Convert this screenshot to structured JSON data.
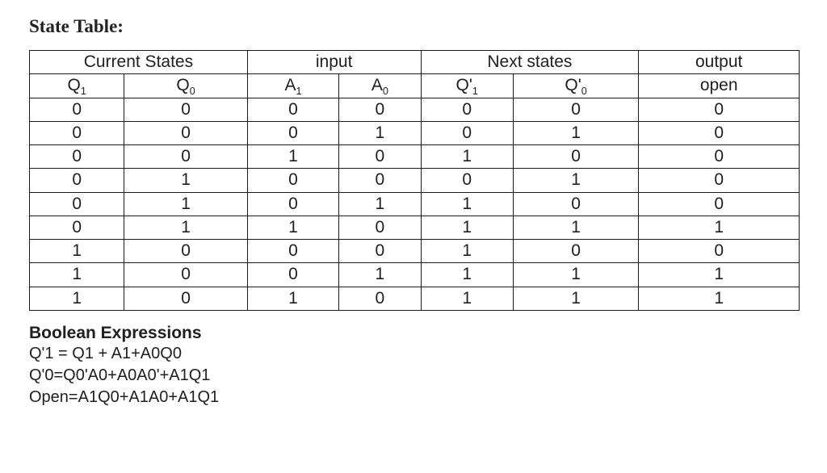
{
  "title": "State Table:",
  "headers": {
    "group_current": "Current States",
    "group_input": "input",
    "group_next": "Next states",
    "group_output": "output",
    "q1": {
      "base": "Q",
      "sub": "1"
    },
    "q0": {
      "base": "Q",
      "sub": "0"
    },
    "a1": {
      "base": "A",
      "sub": "1"
    },
    "a0": {
      "base": "A",
      "sub": "0"
    },
    "qp1": {
      "base": "Q'",
      "sub": "1"
    },
    "qp0": {
      "base": "Q'",
      "sub": "0"
    },
    "out": "open"
  },
  "rows": [
    {
      "q1": "0",
      "q0": "0",
      "a1": "0",
      "a0": "0",
      "qp1": "0",
      "qp0": "0",
      "open": "0"
    },
    {
      "q1": "0",
      "q0": "0",
      "a1": "0",
      "a0": "1",
      "qp1": "0",
      "qp0": "1",
      "open": "0"
    },
    {
      "q1": "0",
      "q0": "0",
      "a1": "1",
      "a0": "0",
      "qp1": "1",
      "qp0": "0",
      "open": "0"
    },
    {
      "q1": "0",
      "q0": "1",
      "a1": "0",
      "a0": "0",
      "qp1": "0",
      "qp0": "1",
      "open": "0"
    },
    {
      "q1": "0",
      "q0": "1",
      "a1": "0",
      "a0": "1",
      "qp1": "1",
      "qp0": "0",
      "open": "0"
    },
    {
      "q1": "0",
      "q0": "1",
      "a1": "1",
      "a0": "0",
      "qp1": "1",
      "qp0": "1",
      "open": "1"
    },
    {
      "q1": "1",
      "q0": "0",
      "a1": "0",
      "a0": "0",
      "qp1": "1",
      "qp0": "0",
      "open": "0"
    },
    {
      "q1": "1",
      "q0": "0",
      "a1": "0",
      "a0": "1",
      "qp1": "1",
      "qp0": "1",
      "open": "1"
    },
    {
      "q1": "1",
      "q0": "0",
      "a1": "1",
      "a0": "0",
      "qp1": "1",
      "qp0": "1",
      "open": "1"
    }
  ],
  "col_widths": {
    "q1": 117,
    "q0": 152,
    "a1": 113,
    "a0": 101,
    "qp1": 114,
    "qp0": 155,
    "open": 198
  },
  "expr_heading": "Boolean Expressions",
  "expr1": "Q'1 = Q1 + A1+A0Q0",
  "expr2": "Q'0=Q0'A0+A0A0'+A1Q1",
  "expr3": "Open=A1Q0+A1A0+A1Q1",
  "chart_data": {
    "type": "table",
    "title": "State Table",
    "columns": [
      "Q1",
      "Q0",
      "A1",
      "A0",
      "Q'1",
      "Q'0",
      "open"
    ],
    "column_groups": {
      "Current States": [
        "Q1",
        "Q0"
      ],
      "input": [
        "A1",
        "A0"
      ],
      "Next states": [
        "Q'1",
        "Q'0"
      ],
      "output": [
        "open"
      ]
    },
    "data": [
      [
        0,
        0,
        0,
        0,
        0,
        0,
        0
      ],
      [
        0,
        0,
        0,
        1,
        0,
        1,
        0
      ],
      [
        0,
        0,
        1,
        0,
        1,
        0,
        0
      ],
      [
        0,
        1,
        0,
        0,
        0,
        1,
        0
      ],
      [
        0,
        1,
        0,
        1,
        1,
        0,
        0
      ],
      [
        0,
        1,
        1,
        0,
        1,
        1,
        1
      ],
      [
        1,
        0,
        0,
        0,
        1,
        0,
        0
      ],
      [
        1,
        0,
        0,
        1,
        1,
        1,
        1
      ],
      [
        1,
        0,
        1,
        0,
        1,
        1,
        1
      ]
    ],
    "boolean_expressions": {
      "Q'1": "Q1 + A1 + A0·Q0",
      "Q'0": "Q0'·A0 + A0·A0' + A1·Q1",
      "Open": "A1·Q0 + A1·A0 + A1·Q1"
    }
  }
}
